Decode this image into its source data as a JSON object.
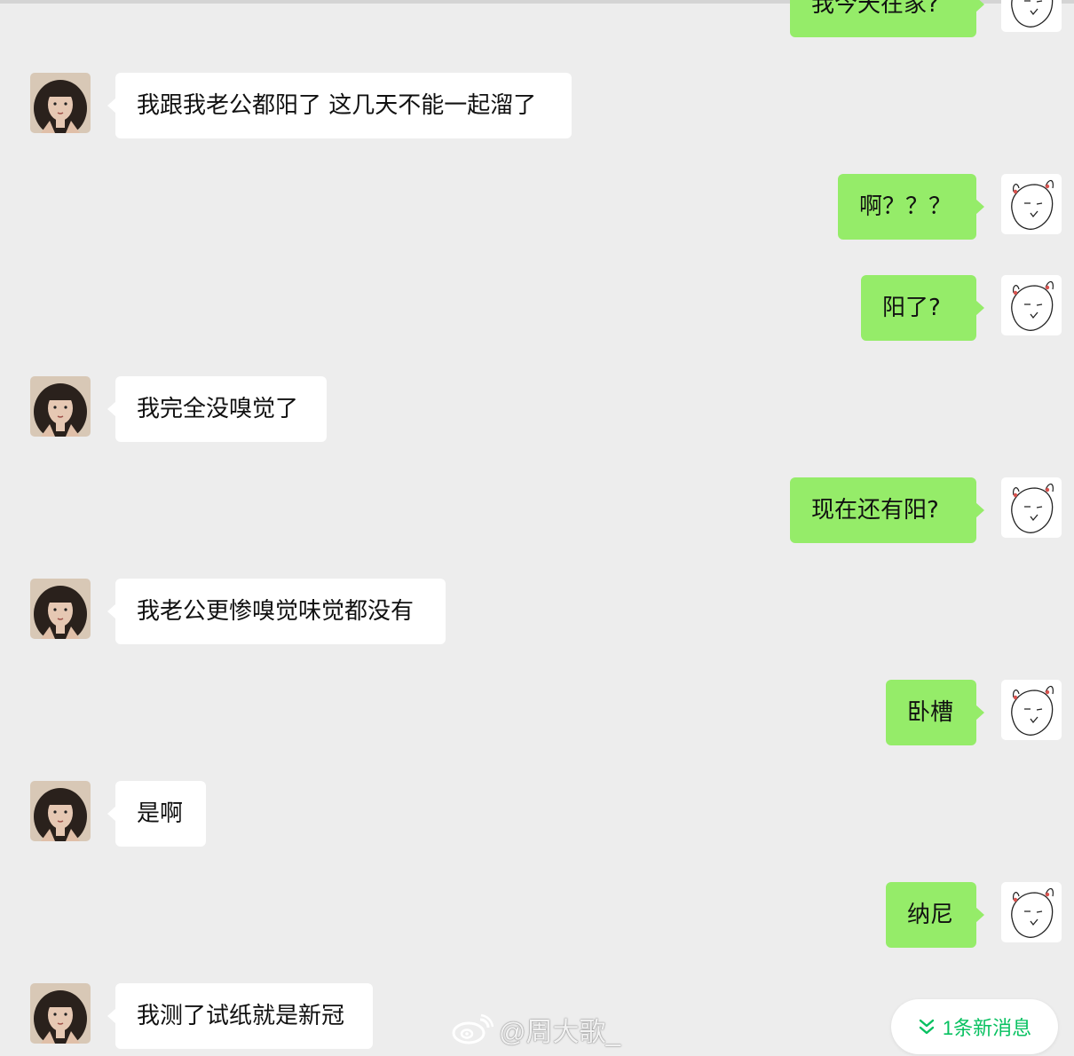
{
  "chat": {
    "messages": [
      {
        "side": "right",
        "text": "我今天在家?",
        "partial": true
      },
      {
        "side": "left",
        "text": "我跟我老公都阳了 这几天不能一起溜了"
      },
      {
        "side": "right",
        "text": "啊？？？"
      },
      {
        "side": "right",
        "text": "阳了?"
      },
      {
        "side": "left",
        "text": "我完全没嗅觉了"
      },
      {
        "side": "right",
        "text": "现在还有阳?"
      },
      {
        "side": "left",
        "text": "我老公更惨嗅觉味觉都没有"
      },
      {
        "side": "right",
        "text": "卧槽"
      },
      {
        "side": "left",
        "text": "是啊"
      },
      {
        "side": "right",
        "text": "纳尼"
      },
      {
        "side": "left",
        "text": "我测了试纸就是新冠"
      }
    ]
  },
  "new_messages_pill": {
    "label": "1条新消息",
    "icon": "double-chevron-down-icon"
  },
  "watermark": {
    "text": "@周大歌_",
    "icon": "weibo-logo"
  },
  "colors": {
    "background": "#ededed",
    "self_bubble": "#95ec69",
    "other_bubble": "#ffffff",
    "accent_green": "#07c160"
  }
}
